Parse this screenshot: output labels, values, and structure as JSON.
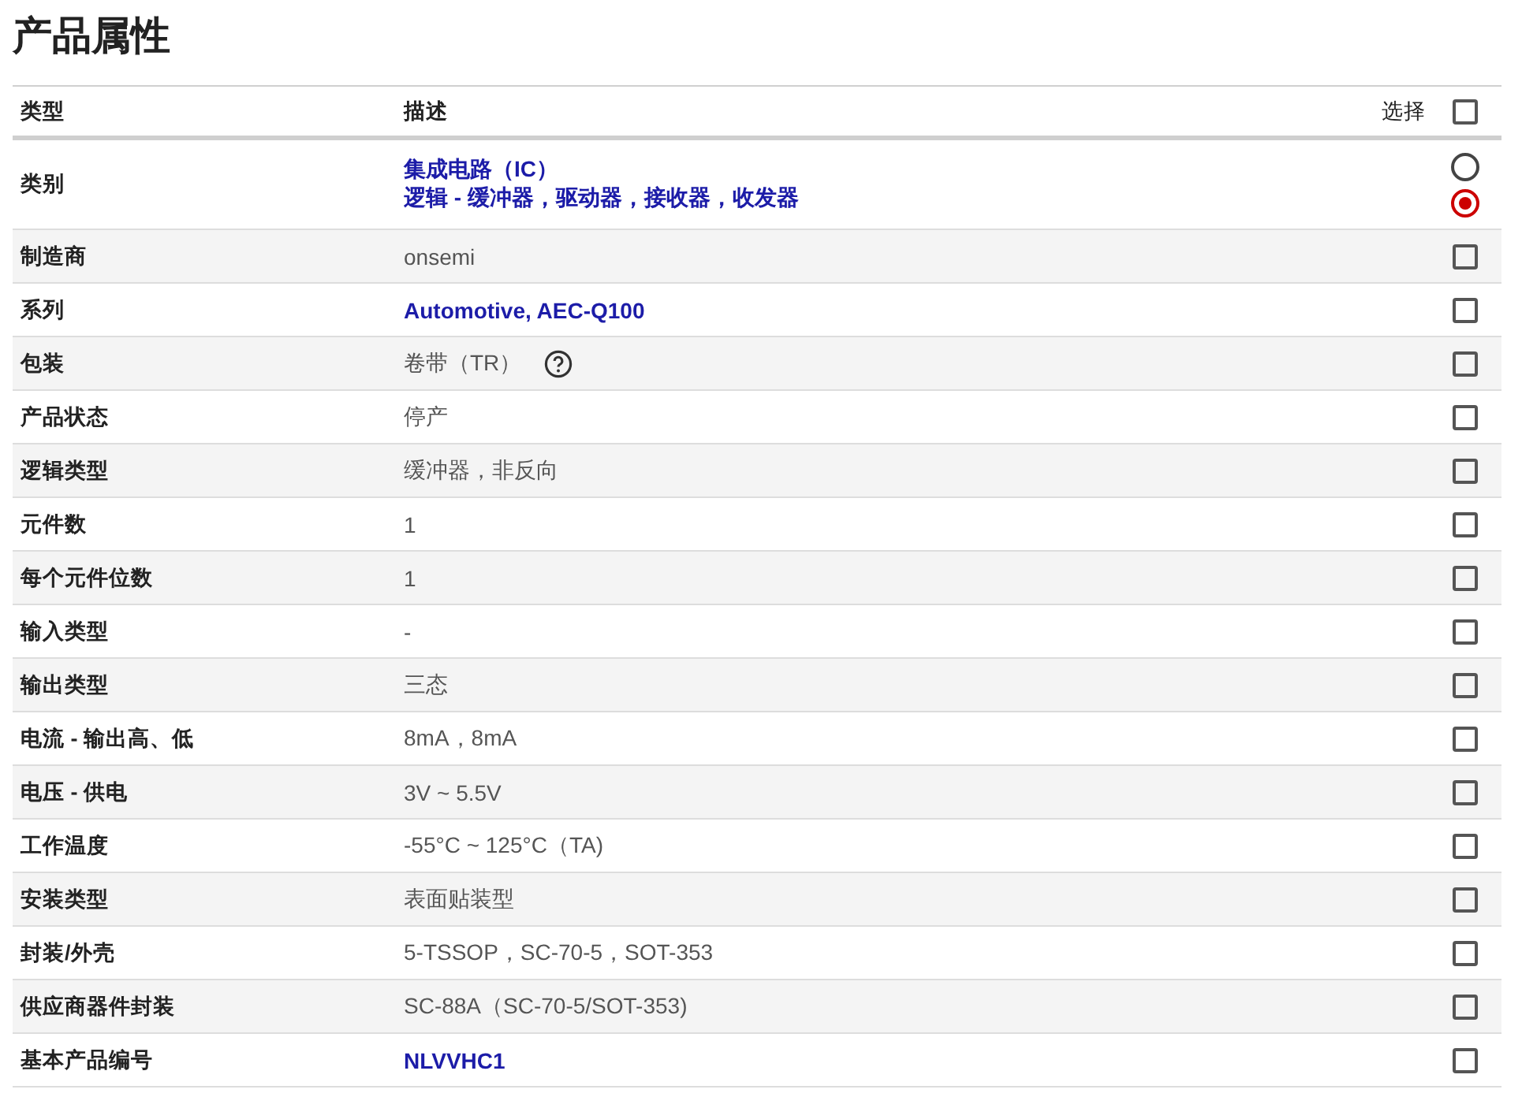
{
  "title": "产品属性",
  "header": {
    "type": "类型",
    "description": "描述",
    "select": "选择",
    "select_all_checked": false
  },
  "rows": [
    {
      "label": "类别",
      "kind": "radio",
      "options": [
        {
          "text": "集成电路（IC）",
          "link": true,
          "selected": false
        },
        {
          "text": "逻辑 - 缓冲器，驱动器，接收器，收发器",
          "link": true,
          "selected": true
        }
      ]
    },
    {
      "label": "制造商",
      "kind": "checkbox",
      "value": "onsemi",
      "link": false,
      "checked": false
    },
    {
      "label": "系列",
      "kind": "checkbox",
      "value": "Automotive, AEC-Q100",
      "link": true,
      "checked": false
    },
    {
      "label": "包装",
      "kind": "checkbox",
      "value": "卷带（TR）",
      "link": false,
      "help": true,
      "checked": false
    },
    {
      "label": "产品状态",
      "kind": "checkbox",
      "value": "停产",
      "link": false,
      "checked": false
    },
    {
      "label": "逻辑类型",
      "kind": "checkbox",
      "value": "缓冲器，非反向",
      "link": false,
      "checked": false
    },
    {
      "label": "元件数",
      "kind": "checkbox",
      "value": "1",
      "link": false,
      "checked": false
    },
    {
      "label": "每个元件位数",
      "kind": "checkbox",
      "value": "1",
      "link": false,
      "checked": false
    },
    {
      "label": "输入类型",
      "kind": "checkbox",
      "value": "-",
      "link": false,
      "checked": false
    },
    {
      "label": "输出类型",
      "kind": "checkbox",
      "value": "三态",
      "link": false,
      "checked": false
    },
    {
      "label": "电流 - 输出高、低",
      "kind": "checkbox",
      "value": "8mA，8mA",
      "link": false,
      "checked": false
    },
    {
      "label": "电压 - 供电",
      "kind": "checkbox",
      "value": "3V ~ 5.5V",
      "link": false,
      "checked": false
    },
    {
      "label": "工作温度",
      "kind": "checkbox",
      "value": "-55°C ~ 125°C（TA)",
      "link": false,
      "checked": false
    },
    {
      "label": "安装类型",
      "kind": "checkbox",
      "value": "表面贴装型",
      "link": false,
      "checked": false
    },
    {
      "label": "封装/外壳",
      "kind": "checkbox",
      "value": "5-TSSOP，SC-70-5，SOT-353",
      "link": false,
      "checked": false
    },
    {
      "label": "供应商器件封装",
      "kind": "checkbox",
      "value": "SC-88A（SC-70-5/SOT-353)",
      "link": false,
      "checked": false
    },
    {
      "label": "基本产品编号",
      "kind": "checkbox",
      "value": "NLVVHC1",
      "link": true,
      "checked": false
    }
  ]
}
